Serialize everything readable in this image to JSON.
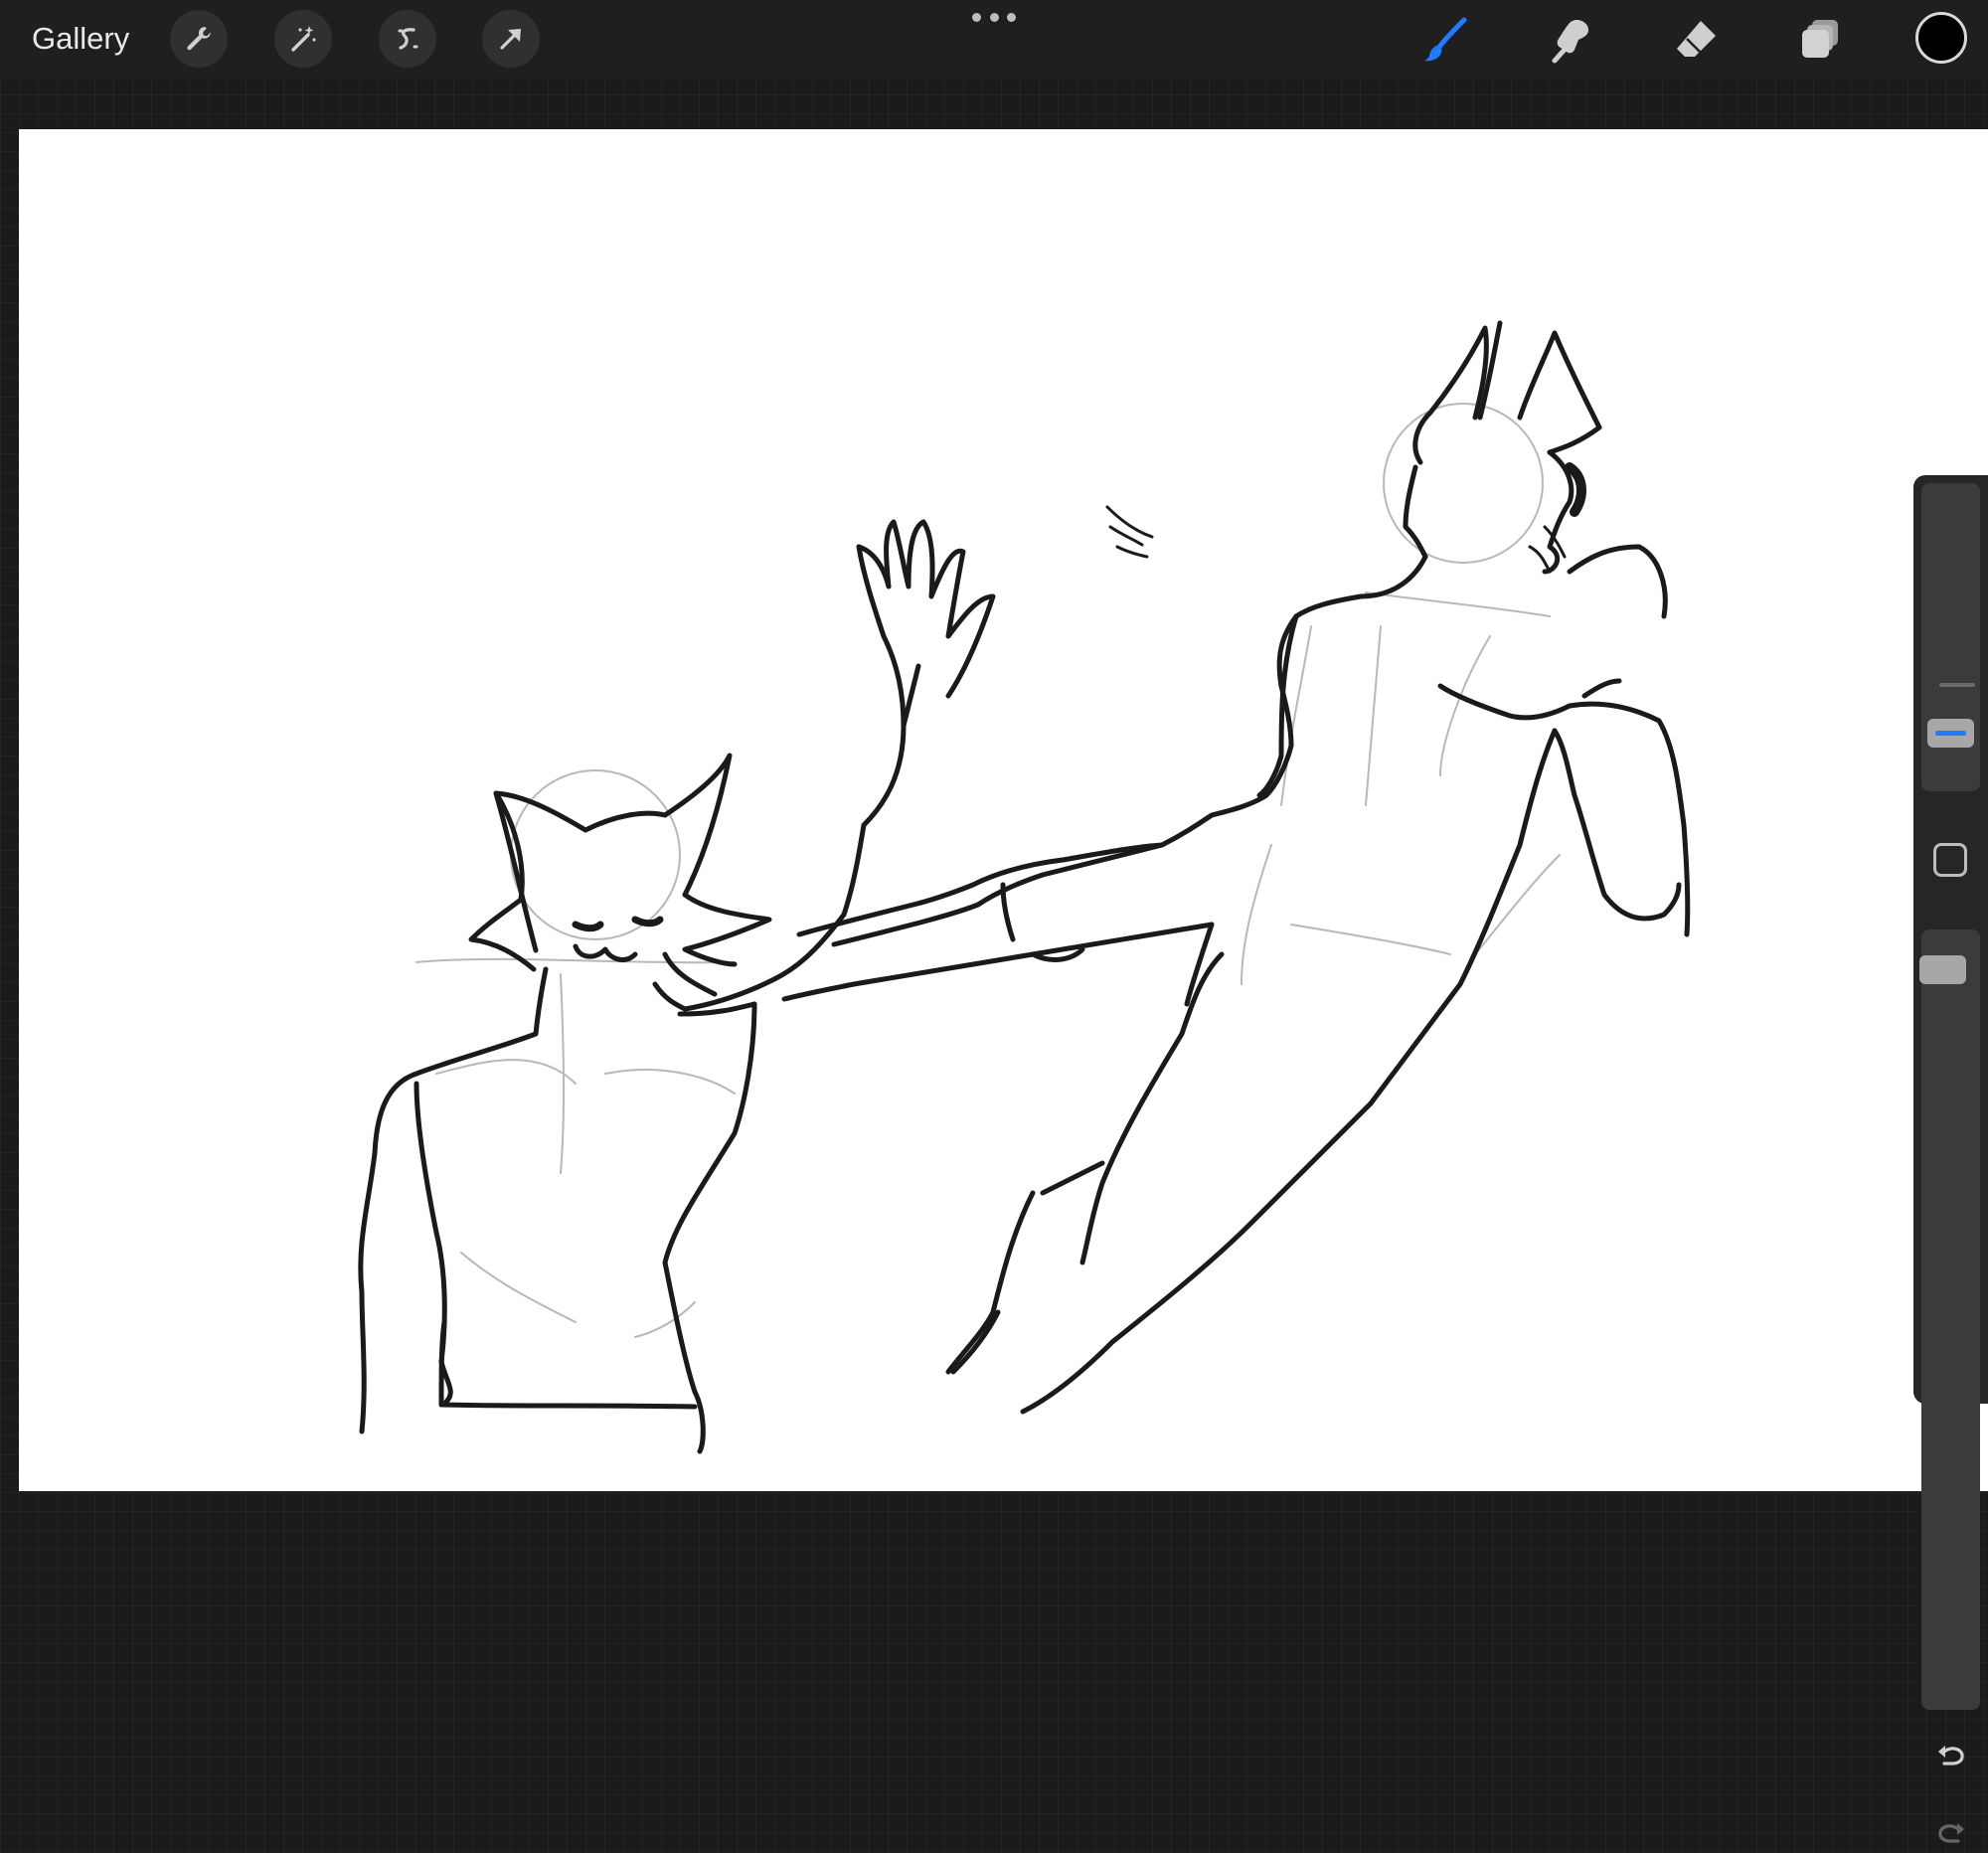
{
  "toolbar": {
    "gallery_label": "Gallery",
    "left_tools": [
      "wrench-icon",
      "magic-wand-icon",
      "selection-icon",
      "transform-icon"
    ],
    "right_tools": [
      "brush-icon",
      "smudge-icon",
      "eraser-icon",
      "layers-icon"
    ],
    "active_tool": "brush",
    "active_tool_color": "#1f7bff",
    "current_color": "#000000"
  },
  "sidebar": {
    "brush_size_level": 0.2,
    "brush_opacity_level": 1.0
  },
  "canvas": {
    "background": "#ffffff",
    "stroke_color": "#1a1a1a"
  }
}
